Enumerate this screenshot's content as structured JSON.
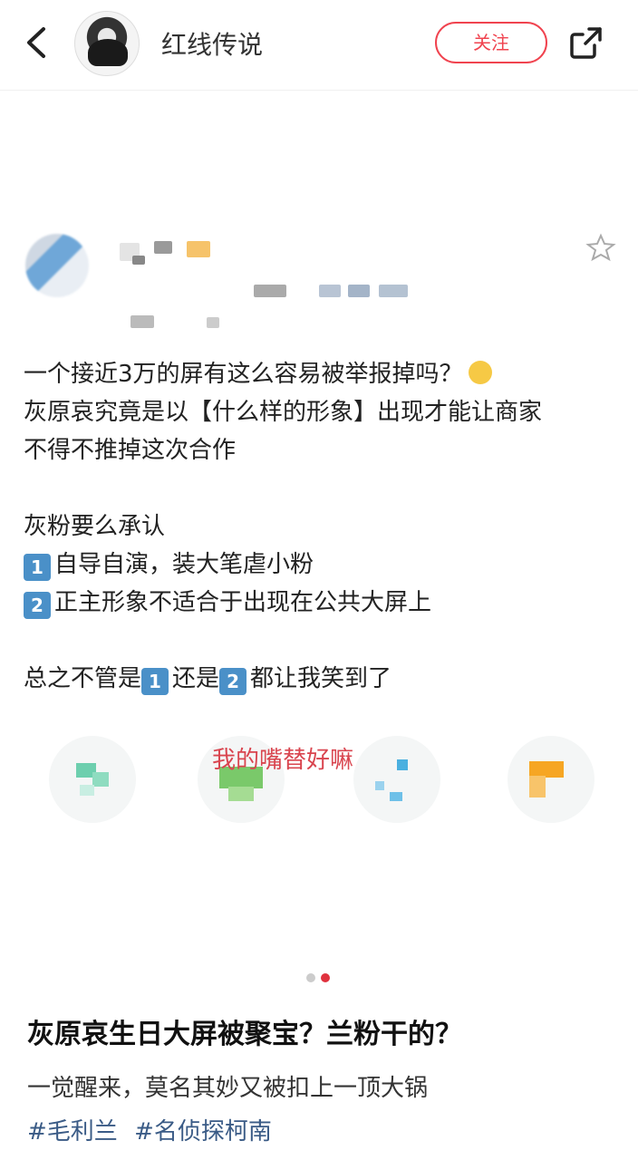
{
  "header": {
    "author_name": "红线传说",
    "follow_label": "关注"
  },
  "embedded_post": {
    "lines": [
      "一个接近3万的屏有这么容易被举报掉吗？",
      "灰原哀究竟是以【什么样的形象】出现才能让商家",
      "不得不推掉这次合作",
      "",
      "灰粉要么承认",
      "自导自演，装大笔虐小粉",
      "正主形象不适合于出现在公共大屏上",
      "",
      "总之不管是",
      "还是",
      "都让我笑到了"
    ],
    "num1": "1",
    "num2": "2",
    "sticker_caption": "我的嘴替好嘛"
  },
  "carousel": {
    "page_count": 2,
    "active_index": 1,
    "active_color": "#e0323e",
    "inactive_color": "#cccccc"
  },
  "note": {
    "title": "灰原哀生日大屏被聚宝？兰粉干的？",
    "description": "一觉醒来，莫名其妙又被扣上一顶大锅",
    "tags": [
      "#毛利兰",
      "#名侦探柯南"
    ]
  },
  "colors": {
    "accent": "#f0434f",
    "tag": "#3a5b86"
  }
}
